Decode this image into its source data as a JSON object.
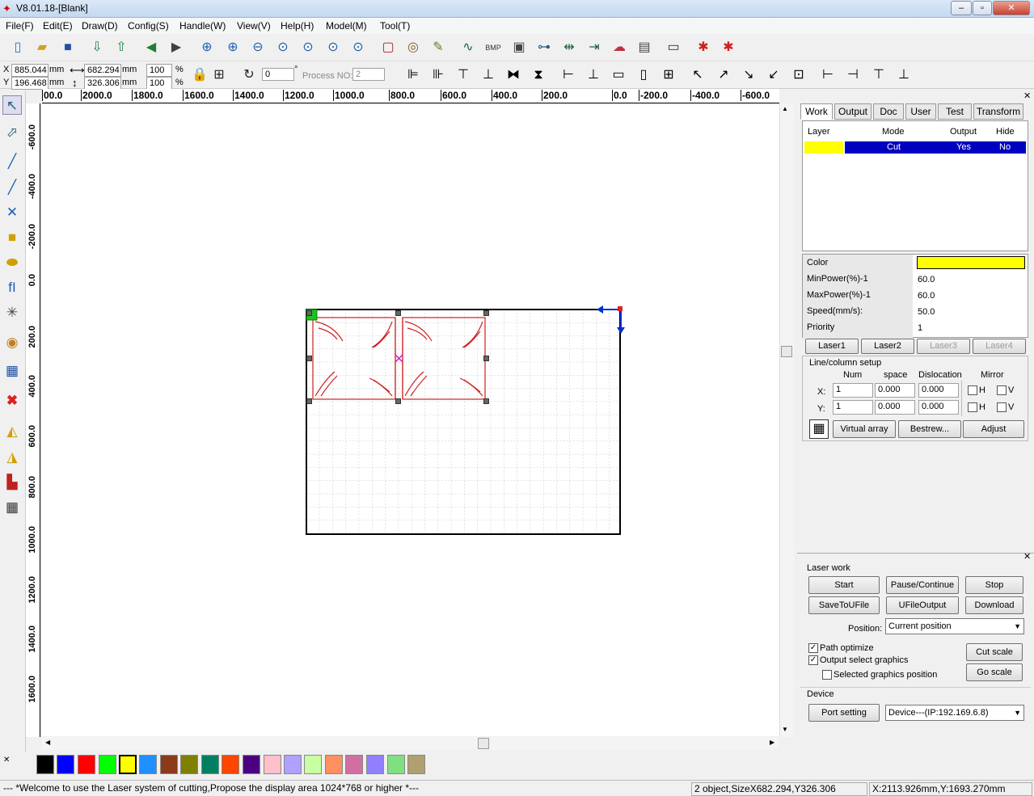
{
  "window": {
    "title": "V8.01.18-[Blank]"
  },
  "menu": [
    "File(F)",
    "Edit(E)",
    "Draw(D)",
    "Config(S)",
    "Handle(W)",
    "View(V)",
    "Help(H)",
    "Model(M)",
    "Tool(T)"
  ],
  "coords": {
    "x_label": "X",
    "y_label": "Y",
    "x": "885.044",
    "y": "196.468",
    "unit": "mm",
    "w": "682.294",
    "h": "326.306",
    "sx": "100",
    "sy": "100",
    "pct": "%",
    "angle": "0",
    "deg": "°",
    "process_label": "Process NO:",
    "process": "2"
  },
  "ruler_h": [
    "00.0",
    "2000.0",
    "1800.0",
    "1600.0",
    "1400.0",
    "1200.0",
    "1000.0",
    "800.0",
    "600.0",
    "400.0",
    "200.0",
    "0.0",
    "-200.0",
    "-400.0",
    "-600.0"
  ],
  "ruler_v": [
    "-600.0",
    "-400.0",
    "-200.0",
    "0.0",
    "200.0",
    "400.0",
    "600.0",
    "800.0",
    "1000.0",
    "1200.0",
    "1400.0",
    "1600.0"
  ],
  "tabs": [
    "Work",
    "Output",
    "Doc",
    "User",
    "Test",
    "Transform"
  ],
  "layers": {
    "headers": [
      "Layer",
      "Mode",
      "Output",
      "Hide"
    ],
    "rows": [
      {
        "color": "#ffff00",
        "mode": "Cut",
        "output": "Yes",
        "hide": "No"
      }
    ]
  },
  "props": [
    {
      "label": "Color",
      "value": ""
    },
    {
      "label": "MinPower(%)-1",
      "value": "60.0"
    },
    {
      "label": "MaxPower(%)-1",
      "value": "60.0"
    },
    {
      "label": "Speed(mm/s):",
      "value": "50.0"
    },
    {
      "label": "Priority",
      "value": "1"
    }
  ],
  "lasers": [
    "Laser1",
    "Laser2",
    "Laser3",
    "Laser4"
  ],
  "array": {
    "title": "Line/column setup",
    "col_num": "Num",
    "col_space": "space",
    "col_disl": "Dislocation",
    "col_mirror": "Mirror",
    "x_label": "X:",
    "y_label": "Y:",
    "x_num": "1",
    "x_space": "0.000",
    "x_disl": "0.000",
    "y_num": "1",
    "y_space": "0.000",
    "y_disl": "0.000",
    "h": "H",
    "v": "V",
    "virtual": "Virtual array",
    "bestrew": "Bestrew...",
    "adjust": "Adjust"
  },
  "laserwork": {
    "title": "Laser work",
    "start": "Start",
    "pause": "Pause/Continue",
    "stop": "Stop",
    "save": "SaveToUFile",
    "ufile": "UFileOutput",
    "download": "Download",
    "position_label": "Position:",
    "position": "Current position",
    "path_opt": "Path optimize",
    "output_sel": "Output select graphics",
    "sel_pos": "Selected graphics position",
    "cut_scale": "Cut scale",
    "go_scale": "Go scale"
  },
  "device": {
    "title": "Device",
    "port": "Port setting",
    "device": "Device---(IP:192.169.6.8)"
  },
  "palette": [
    "#000000",
    "#0000ff",
    "#ff0000",
    "#00ff00",
    "#ffff00",
    "#1e90ff",
    "#8b3a1a",
    "#808000",
    "#008060",
    "#ff4500",
    "#4b0082",
    "#ffc0cb",
    "#b0a0ff",
    "#c8ffa0",
    "#ff9060",
    "#d070a0",
    "#9080ff",
    "#80e080",
    "#b0a070"
  ],
  "palette_first": "#e08070",
  "status": {
    "msg": "--- *Welcome to use the Laser system of cutting,Propose the display area 1024*768 or higher *---",
    "sel": "2 object,SizeX682.294,Y326.306",
    "pos": "X:2113.926mm,Y:1693.270mm"
  }
}
